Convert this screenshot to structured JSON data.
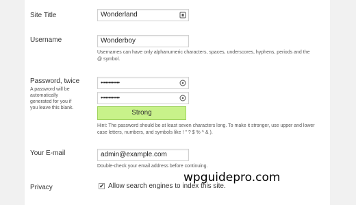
{
  "form": {
    "site_title": {
      "label": "Site Title",
      "value": "Wonderland",
      "icon": "key-icon"
    },
    "username": {
      "label": "Username",
      "value": "Wonderboy",
      "hint": "Usernames can have only alphanumeric characters, spaces, underscores, hyphens, periods and the @ symbol."
    },
    "password": {
      "label": "Password, twice",
      "note": "A password will be automatically generated for you if you leave this blank.",
      "value1": "••••••••••••",
      "value2": "••••••••••••",
      "icon": "lock-icon",
      "strength": "Strong",
      "strength_color": "#c8f28a",
      "hint": "Hint: The password should be at least seven characters long. To make it stronger, use upper and lower case letters, numbers, and symbols like ! \" ? $ % ^ & )."
    },
    "email": {
      "label": "Your E-mail",
      "value": "admin@example.com",
      "hint": "Double-check your email address before continuing."
    },
    "privacy": {
      "label": "Privacy",
      "checkbox_label": "Allow search engines to index this site.",
      "checked": true
    }
  },
  "watermark": "wpguidepro.com"
}
